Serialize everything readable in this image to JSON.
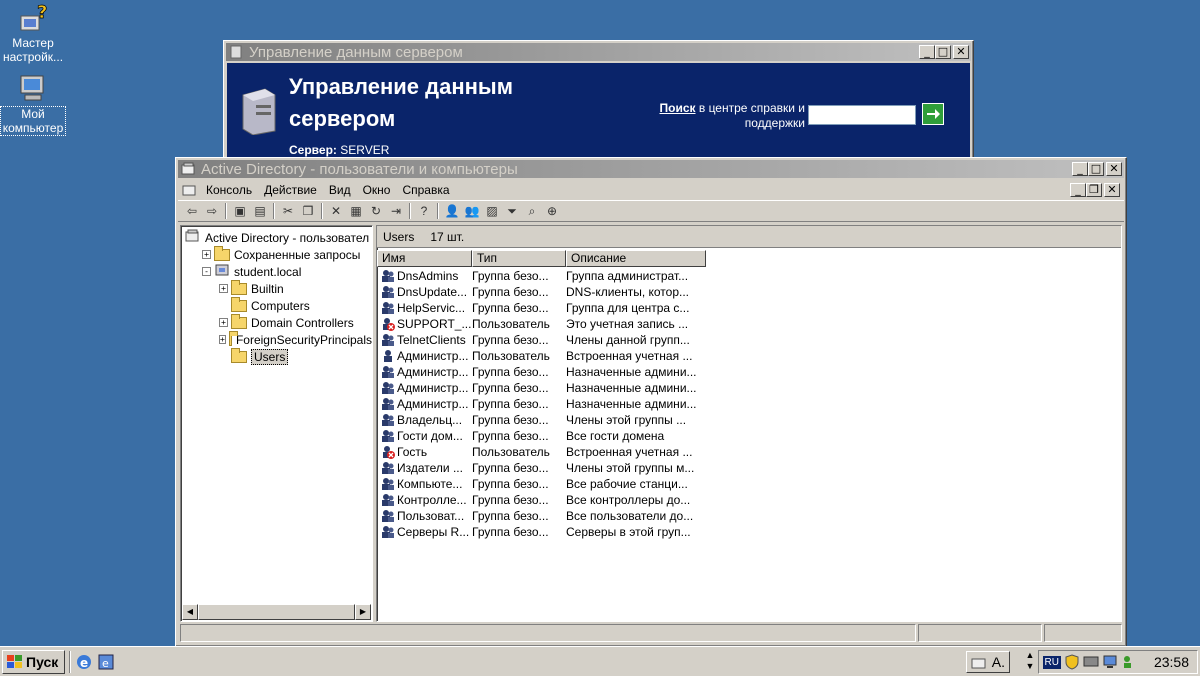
{
  "desktop": {
    "icons": [
      {
        "label": "Мастер настройк..."
      },
      {
        "label": "Мой компьютер"
      }
    ]
  },
  "server_window": {
    "title": "Управление данным сервером",
    "heading_line1": "Управление данным",
    "heading_line2": "сервером",
    "server_label": "Сервер:",
    "server_name": "SERVER",
    "search_bold": "Поиск",
    "search_text_line1": "в центре справки и",
    "search_text_line2": "поддержки",
    "search_value": ""
  },
  "ad_window": {
    "title": "Active Directory - пользователи и компьютеры",
    "menu": [
      "Консоль",
      "Действие",
      "Вид",
      "Окно",
      "Справка"
    ],
    "tree": [
      {
        "label": "Active Directory - пользовател",
        "indent": 0,
        "expander": ""
      },
      {
        "label": "Сохраненные запросы",
        "indent": 1,
        "expander": "+"
      },
      {
        "label": "student.local",
        "indent": 1,
        "expander": "−"
      },
      {
        "label": "Builtin",
        "indent": 2,
        "expander": "+"
      },
      {
        "label": "Computers",
        "indent": 2,
        "expander": ""
      },
      {
        "label": "Domain Controllers",
        "indent": 2,
        "expander": "+"
      },
      {
        "label": "ForeignSecurityPrincipals",
        "indent": 2,
        "expander": "+"
      },
      {
        "label": "Users",
        "indent": 2,
        "expander": ""
      }
    ],
    "right_header_title": "Users",
    "right_header_count": "17 шт.",
    "columns": [
      "Имя",
      "Тип",
      "Описание"
    ],
    "rows": [
      {
        "name": "DnsAdmins",
        "type": "Группа безо...",
        "desc": "Группа администрат...",
        "kind": "group"
      },
      {
        "name": "DnsUpdate...",
        "type": "Группа безо...",
        "desc": "DNS-клиенты, котор...",
        "kind": "group"
      },
      {
        "name": "HelpServic...",
        "type": "Группа безо...",
        "desc": "Группа для центра с...",
        "kind": "group"
      },
      {
        "name": "SUPPORT_...",
        "type": "Пользователь",
        "desc": "Это учетная запись ...",
        "kind": "disabled"
      },
      {
        "name": "TelnetClients",
        "type": "Группа безо...",
        "desc": "Члены данной групп...",
        "kind": "group"
      },
      {
        "name": "Администр...",
        "type": "Пользователь",
        "desc": "Встроенная учетная ...",
        "kind": "user"
      },
      {
        "name": "Администр...",
        "type": "Группа безо...",
        "desc": "Назначенные админи...",
        "kind": "group"
      },
      {
        "name": "Администр...",
        "type": "Группа безо...",
        "desc": "Назначенные админи...",
        "kind": "group"
      },
      {
        "name": "Администр...",
        "type": "Группа безо...",
        "desc": "Назначенные админи...",
        "kind": "group"
      },
      {
        "name": "Владельц...",
        "type": "Группа безо...",
        "desc": "Члены этой группы ...",
        "kind": "group"
      },
      {
        "name": "Гости дом...",
        "type": "Группа безо...",
        "desc": "Все гости домена",
        "kind": "group"
      },
      {
        "name": "Гость",
        "type": "Пользователь",
        "desc": "Встроенная учетная ...",
        "kind": "disabled"
      },
      {
        "name": "Издатели ...",
        "type": "Группа безо...",
        "desc": "Члены этой группы м...",
        "kind": "group"
      },
      {
        "name": "Компьюте...",
        "type": "Группа безо...",
        "desc": "Все рабочие станци...",
        "kind": "group"
      },
      {
        "name": "Контролле...",
        "type": "Группа безо...",
        "desc": "Все контроллеры до...",
        "kind": "group"
      },
      {
        "name": "Пользоват...",
        "type": "Группа безо...",
        "desc": "Все пользователи до...",
        "kind": "group"
      },
      {
        "name": "Серверы R...",
        "type": "Группа безо...",
        "desc": "Серверы в этой груп...",
        "kind": "group"
      }
    ]
  },
  "taskbar": {
    "start_label": "Пуск",
    "task_label": "А.",
    "lang": "RU",
    "clock": "23:58"
  },
  "colors": {
    "desktop": "#3a6ea5",
    "server_banner": "#0a246a",
    "inactive_title": "#808080"
  }
}
